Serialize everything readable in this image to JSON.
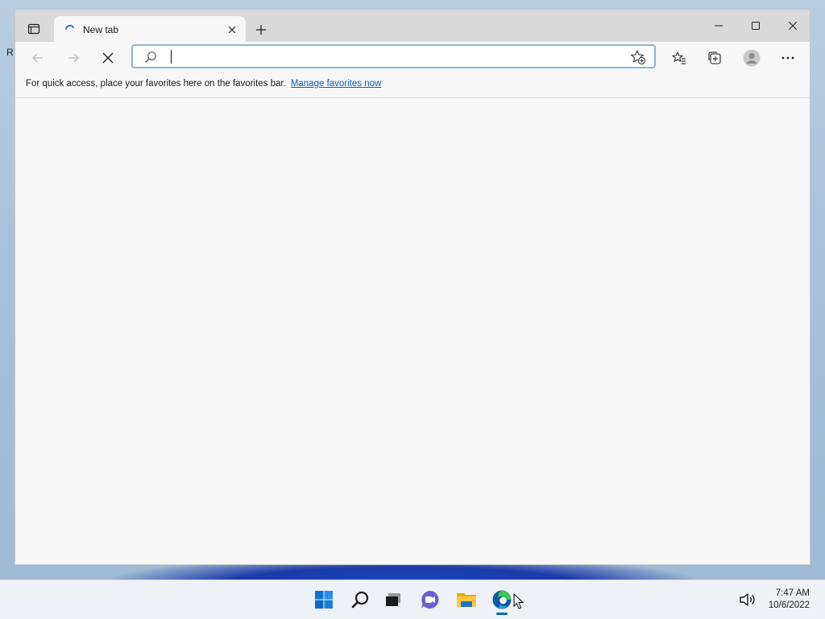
{
  "desktop": {
    "edge_glyph": "R"
  },
  "browser": {
    "tab": {
      "title": "New tab",
      "spinner_icon": "loading-spinner-icon",
      "close_icon": "close-icon"
    },
    "window_controls": {
      "minimize": "minimize-icon",
      "maximize": "maximize-icon",
      "close": "close-icon"
    },
    "address_bar": {
      "value": "",
      "placeholder": "",
      "search_icon": "search-icon",
      "favorite_add_icon": "star-add-icon"
    },
    "toolbar_icons": [
      "back-icon",
      "forward-icon",
      "stop-icon",
      "favorites-icon",
      "collections-icon",
      "profile-icon",
      "more-icon"
    ],
    "favorites_bar": {
      "message": "For quick access, place your favorites here on the favorites bar.",
      "link": "Manage favorites now"
    }
  },
  "taskbar": {
    "apps": [
      "start-icon",
      "search-icon",
      "task-view-icon",
      "teams-chat-icon",
      "file-explorer-icon",
      "edge-icon"
    ],
    "active_app": "edge-icon",
    "clock": {
      "time": "7:47 AM",
      "date": "10/6/2022"
    },
    "volume_icon": "volume-icon"
  },
  "colors": {
    "accent": "#0067c0",
    "link": "#0f5db4",
    "address_focus": "#8fb3d9",
    "edge_blue": "#0c59a4",
    "edge_green": "#3cc25d"
  }
}
